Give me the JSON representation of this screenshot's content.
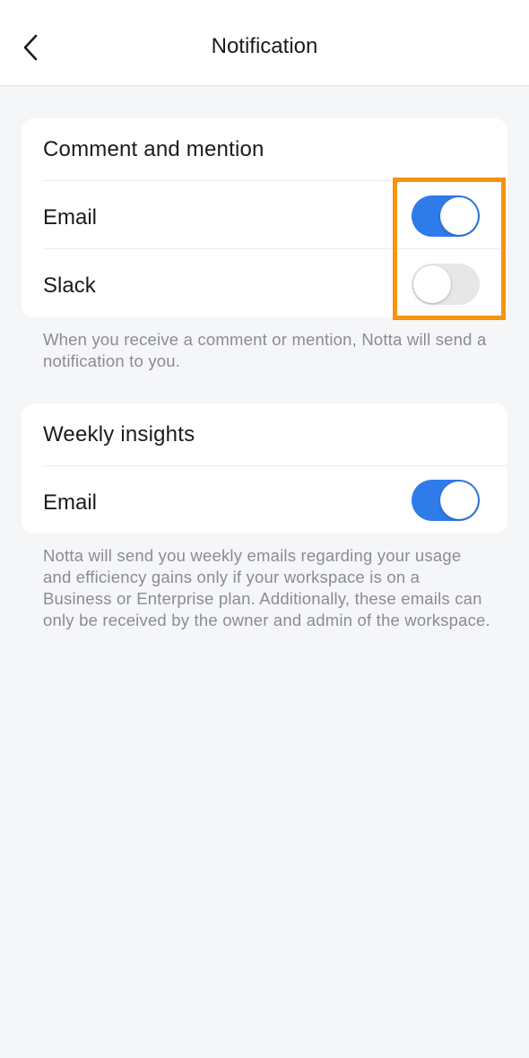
{
  "header": {
    "title": "Notification",
    "back_icon": "chevron-left-icon"
  },
  "sections": [
    {
      "title": "Comment and mention",
      "rows": [
        {
          "label": "Email",
          "enabled": true
        },
        {
          "label": "Slack",
          "enabled": false
        }
      ],
      "helper": "When you receive a comment or mention, Notta will send a notification to you."
    },
    {
      "title": "Weekly insights",
      "rows": [
        {
          "label": "Email",
          "enabled": true
        }
      ],
      "helper": "Notta will send you weekly emails regarding your usage and efficiency gains only if your workspace is on a Business or Enterprise plan. Additionally, these emails can only be received by the owner and admin of the workspace."
    }
  ],
  "colors": {
    "toggle_on": "#2f7bea",
    "toggle_off": "#e7e7ea",
    "highlight": "#f7930f",
    "background": "#f5f6f8"
  }
}
